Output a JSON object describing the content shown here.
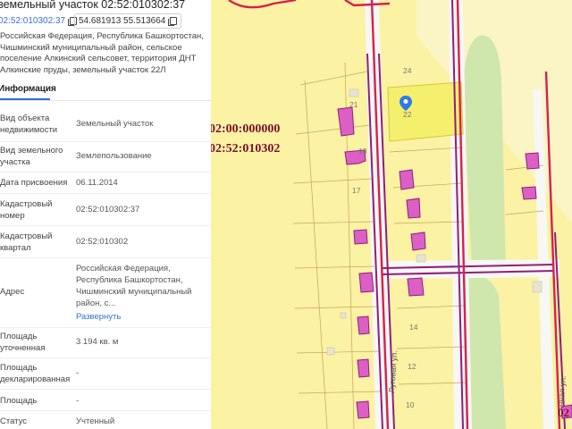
{
  "panel": {
    "title": "земельный участок 02:52:010302:37",
    "cadastral_chip": "02:52:010302:37",
    "coords_chip": "54.681913 55.513664",
    "address_lines": [
      "Российская Федерация, Республика Башкортостан,",
      "Чишминский муниципальный район, сельское",
      "поселение Алкинский сельсовет, территория ДНТ",
      "Алкинские пруды, земельный участок 22Л"
    ],
    "tab_info": "Информация",
    "rows": [
      {
        "label": [
          "Вид объекта",
          "недвижимости"
        ],
        "value": [
          "Земельный участок"
        ]
      },
      {
        "label": [
          "Вид земельного",
          "участка"
        ],
        "value": [
          "Землепользование"
        ]
      },
      {
        "label": [
          "Дата присвоения"
        ],
        "value": [
          "06.11.2014"
        ]
      },
      {
        "label": [
          "Кадастровый",
          "номер"
        ],
        "value": [
          "02:52:010302:37"
        ]
      },
      {
        "label": [
          "Кадастровый",
          "квартал"
        ],
        "value": [
          "02:52:010302"
        ]
      },
      {
        "label": [
          "Адрес"
        ],
        "value": [
          "Российская Федерация,",
          "Республика Башкортостан,",
          "Чишминский муниципальный",
          "район, с..."
        ],
        "link": "Развернуть"
      },
      {
        "label": [
          "Площадь",
          "уточненная"
        ],
        "value": [
          "3 194 кв. м"
        ]
      },
      {
        "label": [
          "Площадь",
          "декларированная"
        ],
        "value": [
          "-"
        ]
      },
      {
        "label": [
          "Площадь"
        ],
        "value": [
          "-"
        ]
      },
      {
        "label": [
          "Статус"
        ],
        "value": [
          "Учтенный"
        ]
      }
    ]
  },
  "map": {
    "label_root": "02:00:000000",
    "label_quarter": "02:52:010302",
    "label_edge": "02",
    "street_lugovaya": "Луговая ул.",
    "street_right": "...чная ул.",
    "parcel_numbers": [
      "24",
      "21",
      "22",
      "18",
      "17",
      "14",
      "12",
      "10"
    ],
    "colors": {
      "land": "#fbf2a3",
      "selected": "#f5ef6e",
      "road": "#f7f7f3",
      "border": "#8e1f7b",
      "red_line": "#d6214d",
      "green": "#cfe6ad",
      "building": "#dc5fc6",
      "label_red": "#7a1230",
      "marker": "#2f7be9"
    }
  }
}
